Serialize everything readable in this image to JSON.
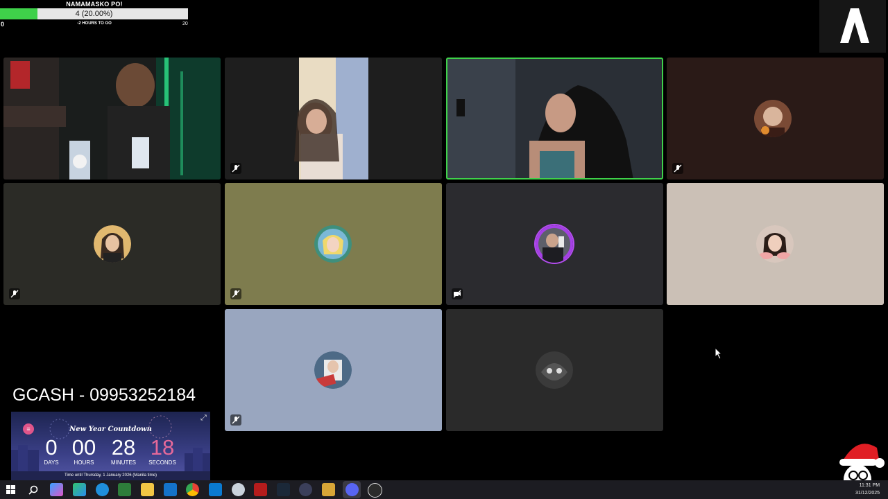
{
  "goal": {
    "title": "NAMAMASKO PO!",
    "progress_text": "4 (20.00%)",
    "progress_fraction": 0.2,
    "min": "0",
    "max": "20",
    "subtitle": "-2 HOURS TO GO"
  },
  "tiles": [
    {
      "id": "host-video",
      "muted": false,
      "speaking": false,
      "bg": "#1b2a22"
    },
    {
      "id": "video-2",
      "muted": true,
      "speaking": false,
      "bg": "#1e1e1e"
    },
    {
      "id": "video-3",
      "muted": false,
      "speaking": true,
      "bg": "#23272c"
    },
    {
      "id": "avatar-4",
      "muted": true,
      "speaking": false,
      "bg": "#2a1a17"
    },
    {
      "id": "avatar-5",
      "muted": true,
      "speaking": false,
      "bg": "#2b2b26"
    },
    {
      "id": "avatar-6",
      "muted": true,
      "speaking": false,
      "bg": "#7e7c4e"
    },
    {
      "id": "avatar-7",
      "muted": true,
      "speaking": false,
      "bg": "#2b2b2f"
    },
    {
      "id": "avatar-8",
      "muted": false,
      "speaking": false,
      "bg": "#cbc0b6"
    },
    {
      "id": "avatar-9",
      "muted": true,
      "speaking": false,
      "bg": "#99a6bf"
    },
    {
      "id": "avatar-10",
      "muted": false,
      "speaking": false,
      "bg": "#2a2a2a"
    }
  ],
  "gcash": "GCASH - 09953252184",
  "countdown": {
    "title": "New Year Countdown",
    "days": "0",
    "hours": "00",
    "minutes": "28",
    "seconds": "18",
    "days_label": "DAYS",
    "hours_label": "HOURS",
    "minutes_label": "MINUTES",
    "seconds_label": "SECONDS",
    "footer": "Time until Thursday, 1 January 2026 (Manila time)"
  },
  "taskbar": {
    "icons": [
      "windows-start-icon",
      "search-icon",
      "copilot-icon",
      "edge-icon",
      "edge-icon-2",
      "file-explorer-icon",
      "outlook-icon",
      "chrome-icon",
      "store-icon",
      "app-icon",
      "voice-changer-icon",
      "steam-icon",
      "calculator-icon",
      "tool-icon",
      "discord-icon",
      "obs-icon"
    ],
    "clock_time": "11:31 PM",
    "clock_date": "31/12/2025"
  },
  "colors": {
    "speaking": "#3fd14a",
    "progress": "#3fd14a",
    "countdown_seconds": "#e6699a"
  }
}
